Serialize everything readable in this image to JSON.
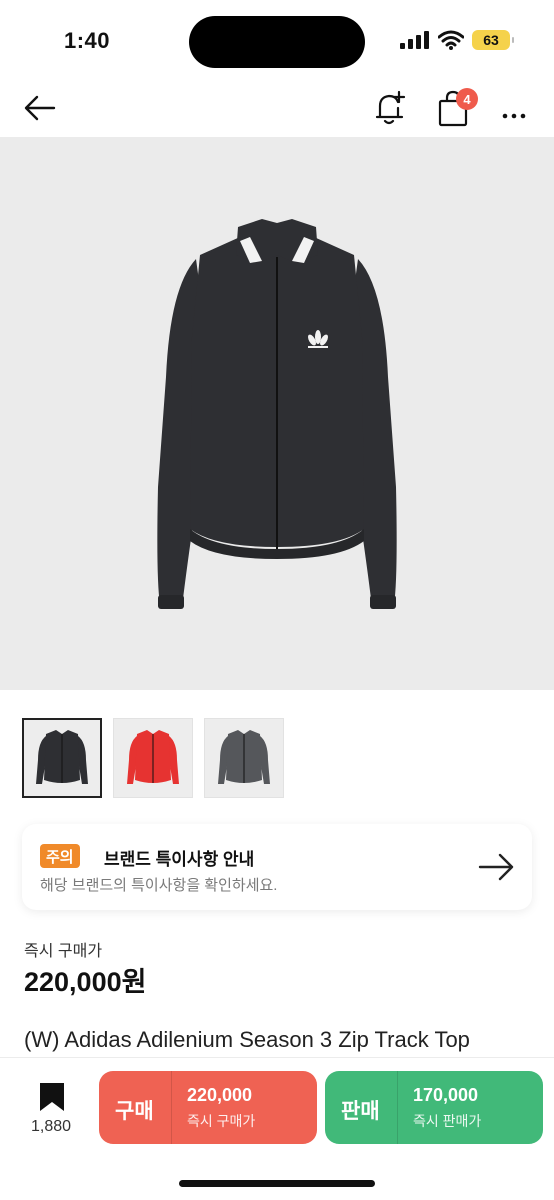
{
  "status_bar": {
    "time": "1:40",
    "battery": "63"
  },
  "header": {
    "cart_badge": "4"
  },
  "gallery": {
    "main_color": "#2e2f33",
    "thumbnails": [
      {
        "color": "#2e2f33",
        "selected": true
      },
      {
        "color": "#e63331",
        "selected": false
      },
      {
        "color": "#55575b",
        "selected": false
      }
    ]
  },
  "notice": {
    "tag": "주의",
    "title": "브랜드 특이사항 안내",
    "subtitle": "해당 브랜드의 특이사항을 확인하세요."
  },
  "price": {
    "label": "즉시 구매가",
    "value": "220,000원"
  },
  "product": {
    "title": "(W) Adidas Adilenium Season 3 Zip Track Top"
  },
  "bottom": {
    "bookmark_count": "1,880",
    "buy": {
      "label": "구매",
      "price": "220,000",
      "sub": "즉시 구매가",
      "color": "#ef6253"
    },
    "sell": {
      "label": "판매",
      "price": "170,000",
      "sub": "즉시 판매가",
      "color": "#41b979"
    }
  }
}
